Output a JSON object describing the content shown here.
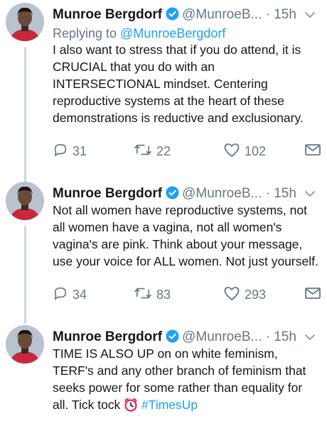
{
  "tweets": [
    {
      "name": "Munroe Bergdorf",
      "handle": "@MunroeB...",
      "dot": "·",
      "time": "15h",
      "reply_prefix": "Replying to",
      "reply_to": "@MunroeBergdorf",
      "text": "I also want to stress that if you do attend, it is CRUCIAL that you do with an INTERSECTIONAL mindset. Centering reproductive systems at the heart of these demonstrations is reductive and exclusionary.",
      "replies": "31",
      "retweets": "22",
      "likes": "102"
    },
    {
      "name": "Munroe Bergdorf",
      "handle": "@MunroeB...",
      "dot": "·",
      "time": "15h",
      "text": "Not all women have reproductive systems, not all women have a vagina, not all women's vagina's are pink. Think about your message, use your voice for ALL women. Not just yourself.",
      "replies": "34",
      "retweets": "83",
      "likes": "293"
    },
    {
      "name": "Munroe Bergdorf",
      "handle": "@MunroeB...",
      "dot": "·",
      "time": "15h",
      "text": "TIME IS ALSO UP on on white feminism, TERF's and any other branch of feminism that seeks power for some rather than equality for all. Tick tock",
      "emoji": "alarm-clock-icon",
      "hashtag": "#TimesUp"
    }
  ],
  "colors": {
    "accent": "#1da1f2",
    "muted": "#657786",
    "text": "#14171a",
    "thread_line": "#ccd6dd",
    "clock_red": "#e0245e"
  }
}
